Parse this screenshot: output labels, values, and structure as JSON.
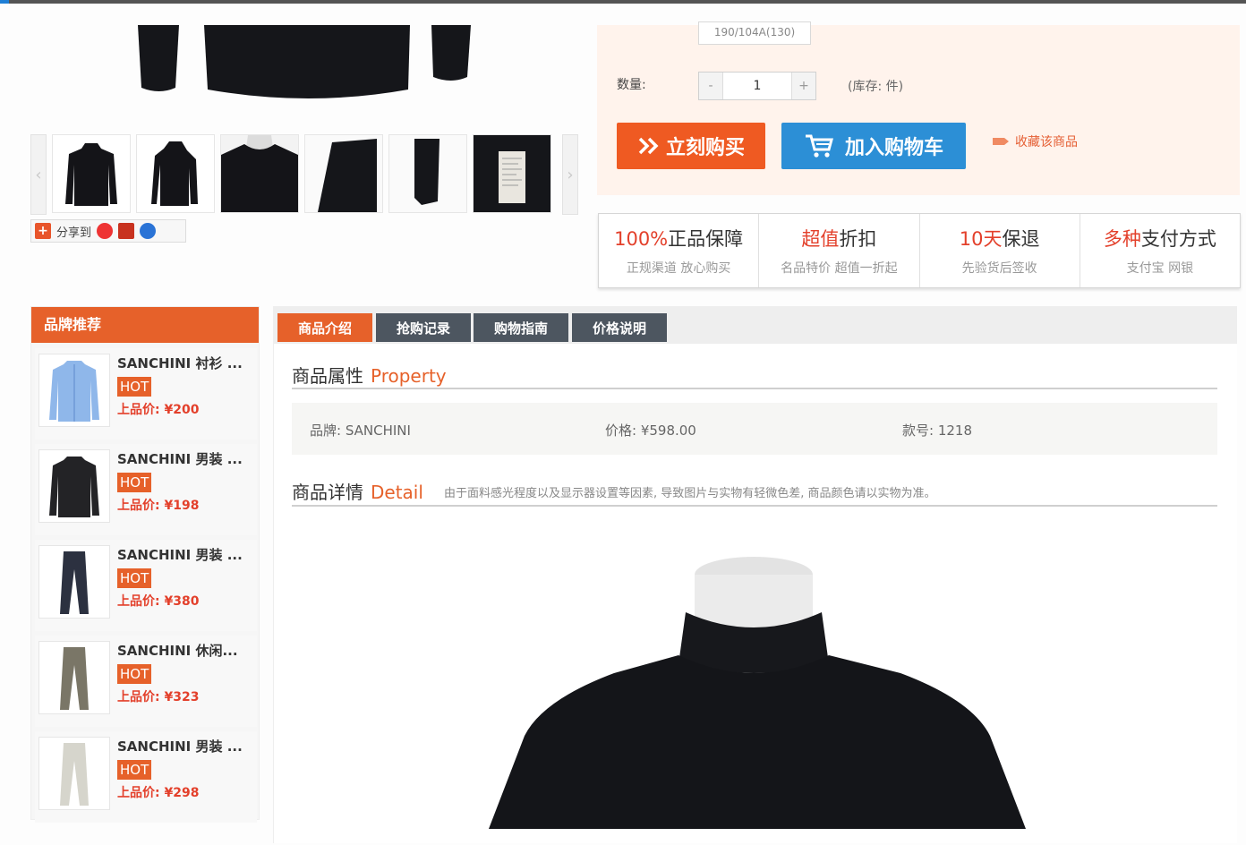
{
  "main": {
    "size_option": "190/104A(130)",
    "qty_label": "数量:",
    "qty_minus": "-",
    "qty_value": "1",
    "qty_plus": "+",
    "stock_text": "(库存: 件)",
    "buy_now": "立刻购买",
    "buy_now_icon": "double-chevron-right-icon",
    "add_to_cart": "加入购物车",
    "cart_icon": "shopping-cart-icon",
    "favorite": "收藏该商品",
    "share_label": "分享到",
    "share_plus": "+",
    "thumb_prev": "‹",
    "thumb_next": "›"
  },
  "guarantees": [
    {
      "highlight": "100%",
      "rest": "正品保障",
      "sub": "正规渠道 放心购买"
    },
    {
      "highlight": "超值",
      "rest": "折扣",
      "sub": "名品特价 超值一折起"
    },
    {
      "highlight": "10天",
      "rest": "保退",
      "sub": "先验货后签收"
    },
    {
      "highlight": "多种",
      "rest": "支付方式",
      "sub": "支付宝 网银"
    }
  ],
  "sidebar": {
    "title": "品牌推荐",
    "items": [
      {
        "name": "SANCHINI 衬衫 ...",
        "hot": "HOT",
        "price": "上品价: ¥200"
      },
      {
        "name": "SANCHINI 男装 ...",
        "hot": "HOT",
        "price": "上品价: ¥198"
      },
      {
        "name": "SANCHINI 男装 ...",
        "hot": "HOT",
        "price": "上品价: ¥380"
      },
      {
        "name": "SANCHINI 休闲...",
        "hot": "HOT",
        "price": "上品价: ¥323"
      },
      {
        "name": "SANCHINI 男装 ...",
        "hot": "HOT",
        "price": "上品价: ¥298"
      }
    ]
  },
  "tabs": [
    "商品介绍",
    "抢购记录",
    "购物指南",
    "价格说明"
  ],
  "property": {
    "title_cn": "商品属性",
    "title_en": "Property",
    "brand": "品牌: SANCHINI",
    "price": "价格: ¥598.00",
    "code": "款号: 1218"
  },
  "detail": {
    "title_cn": "商品详情",
    "title_en": "Detail",
    "note": "由于面料感光程度以及显示器设置等因素, 导致图片与实物有轻微色差, 商品颜色请以实物为准。"
  },
  "colors": {
    "accent": "#e6612a",
    "red": "#e3402b",
    "blue": "#2c8fd6",
    "tab_dark": "#4d5660"
  }
}
